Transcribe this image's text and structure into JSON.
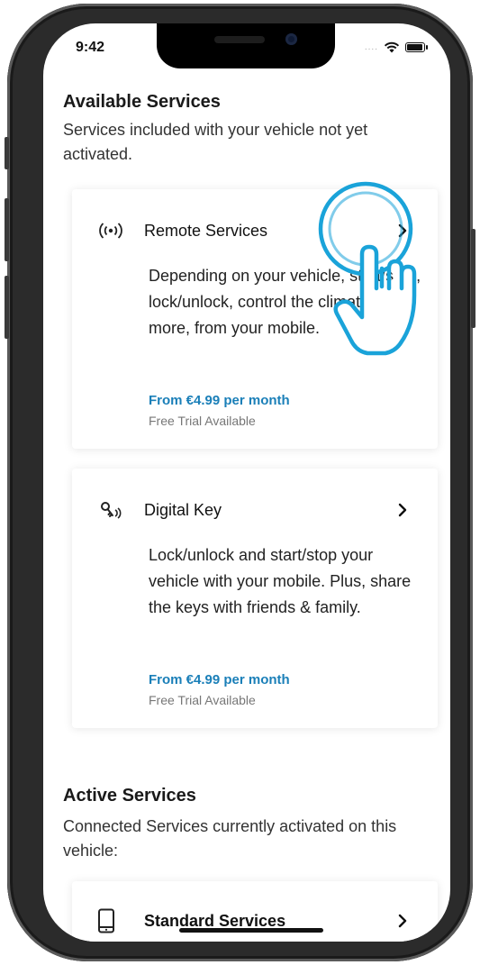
{
  "status_bar": {
    "time": "9:42",
    "signal": "....",
    "battery_level": 0.85
  },
  "available": {
    "title": "Available Services",
    "description": "Services included with your vehicle not yet activated.",
    "cards": [
      {
        "icon": "remote-signal-icon",
        "title": "Remote Services",
        "description": "Depending on your vehicle, start/stop, lock/unlock, control the climate, and more, from your mobile.",
        "price": "From €4.99 per month",
        "trial": "Free Trial Available"
      },
      {
        "icon": "digital-key-icon",
        "title": "Digital Key",
        "description": "Lock/unlock and start/stop your vehicle with your mobile. Plus, share the keys with friends & family.",
        "price": "From €4.99 per month",
        "trial": "Free Trial Available"
      }
    ]
  },
  "active": {
    "title": "Active Services",
    "description": "Connected Services currently activated on this vehicle:",
    "cards": [
      {
        "icon": "phone-icon",
        "title": "Standard Services"
      }
    ]
  },
  "colors": {
    "accent": "#1a7fb8",
    "tap_highlight": "#1aa3d9"
  }
}
